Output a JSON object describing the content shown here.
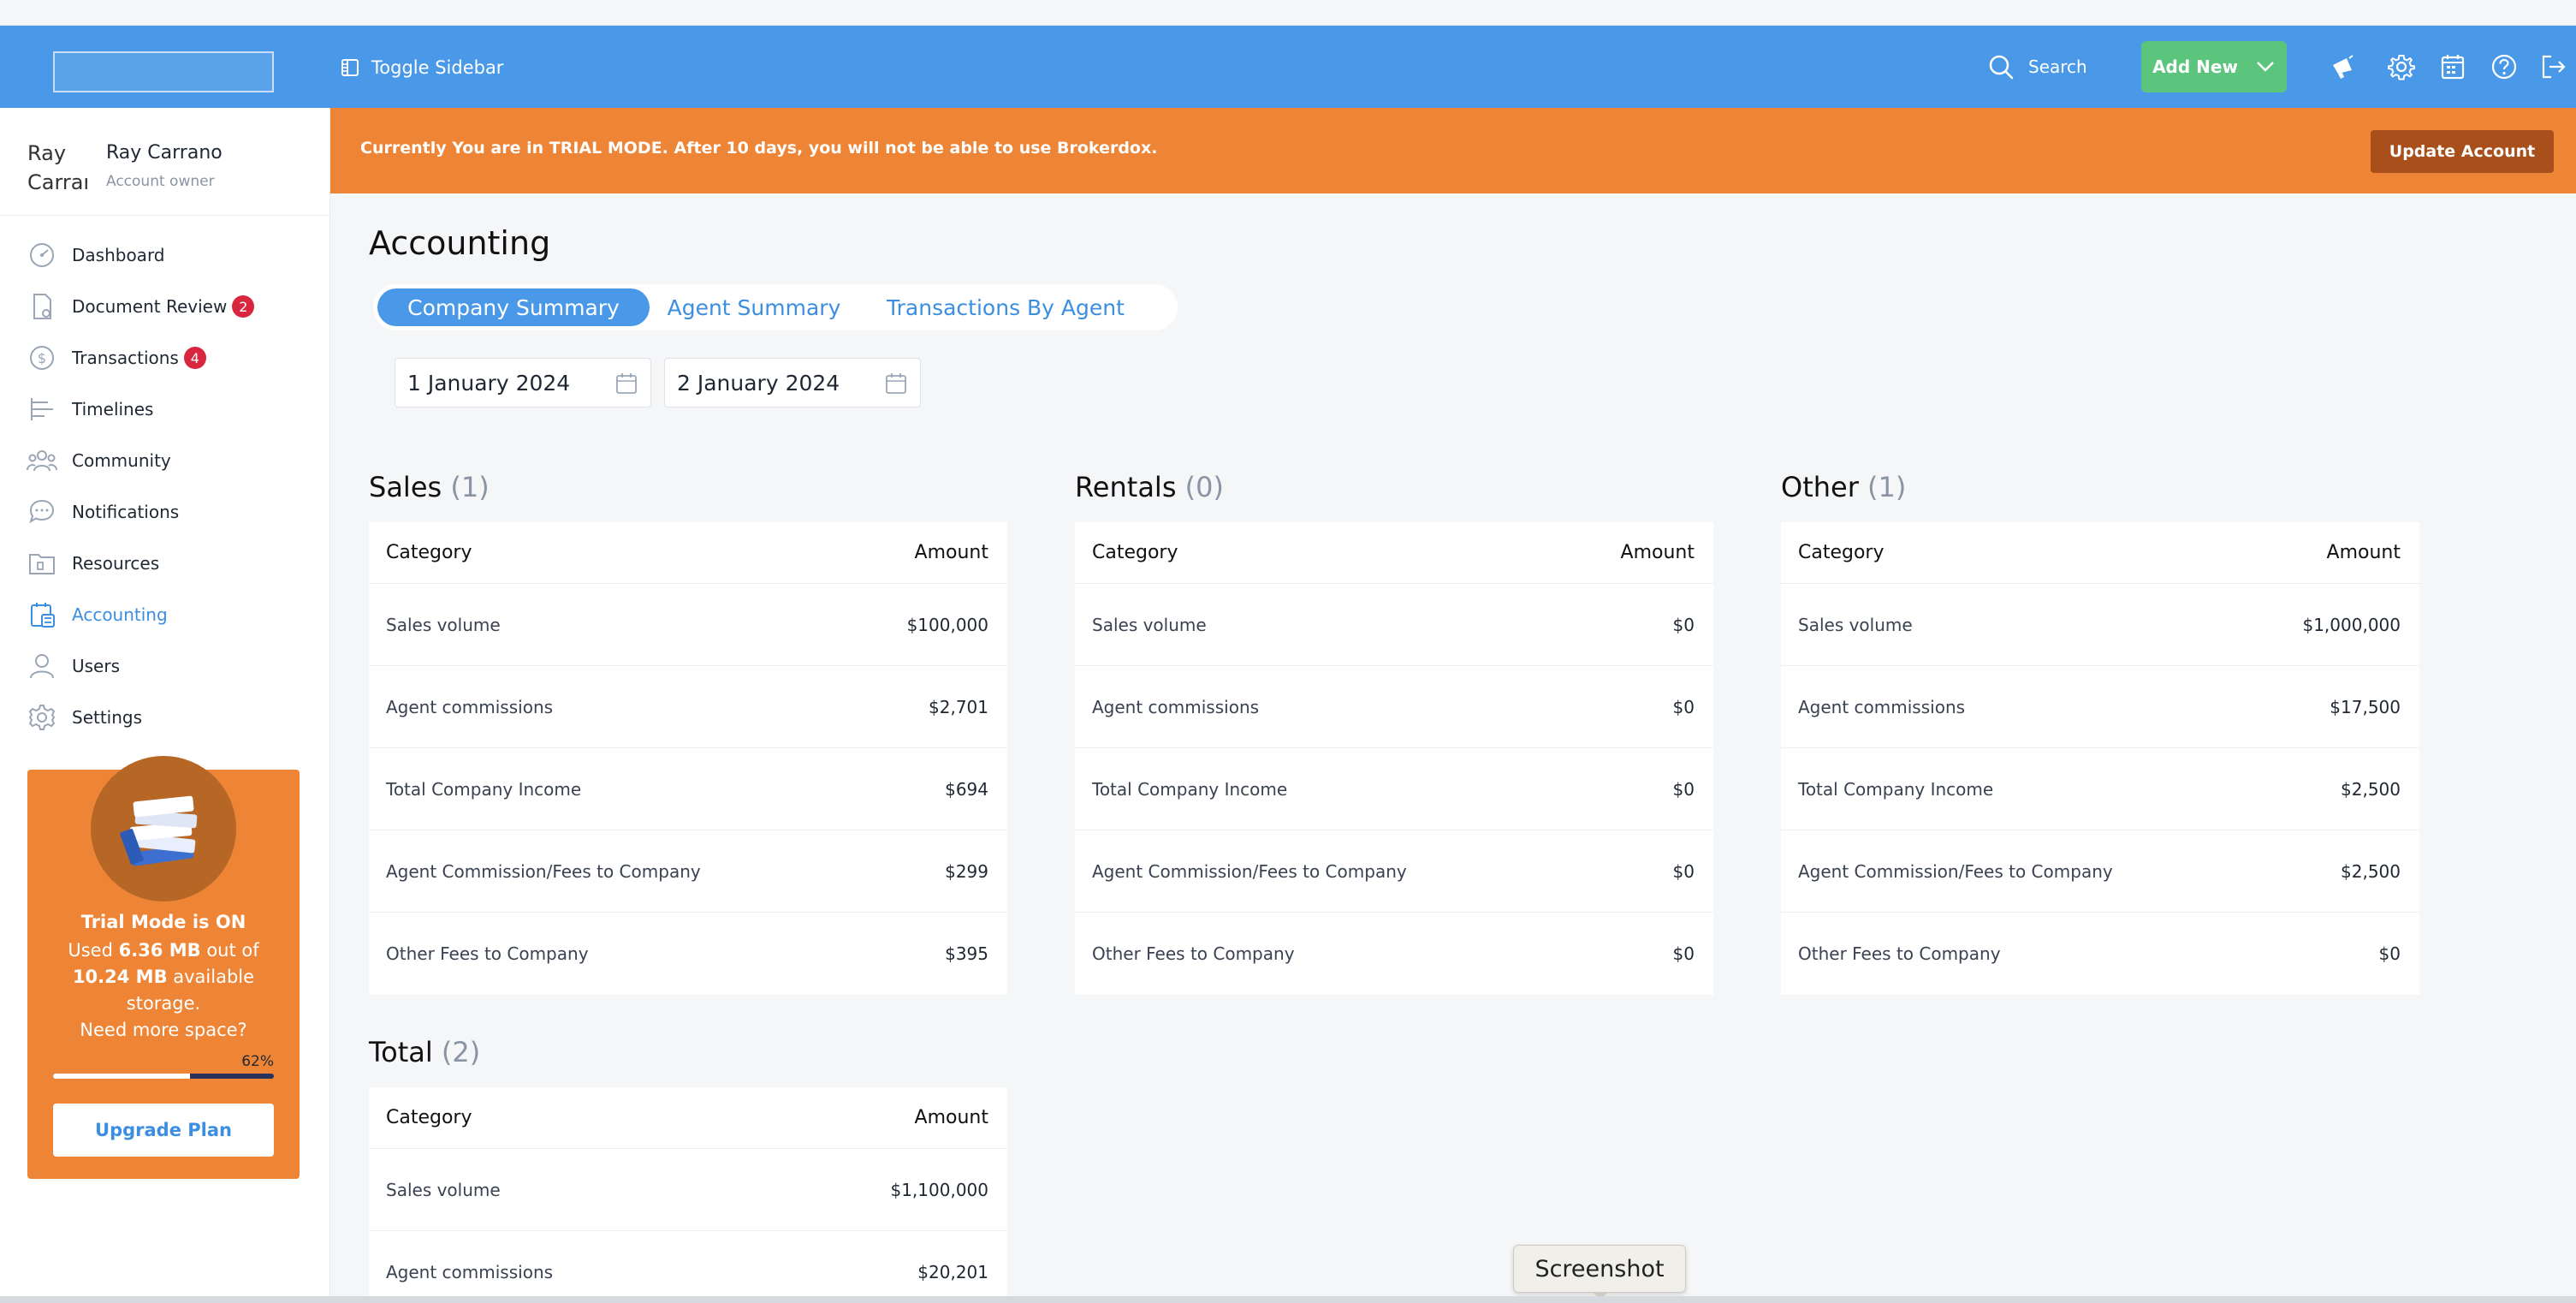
{
  "header": {
    "toggle_label": "Toggle Sidebar",
    "search_label": "Search",
    "add_new_label": "Add New",
    "accent": "#4a99e8"
  },
  "sidebar": {
    "user_name": "Ray Carrano",
    "user_role": "Account owner",
    "avatar_alt": "Ray Carrano",
    "items": [
      {
        "label": "Dashboard",
        "icon": "dashboard-icon"
      },
      {
        "label": "Document Review",
        "icon": "document-icon",
        "badge": "2"
      },
      {
        "label": "Transactions",
        "icon": "dollar-icon",
        "badge": "4"
      },
      {
        "label": "Timelines",
        "icon": "timeline-icon"
      },
      {
        "label": "Community",
        "icon": "community-icon"
      },
      {
        "label": "Notifications",
        "icon": "chat-icon"
      },
      {
        "label": "Resources",
        "icon": "folder-icon"
      },
      {
        "label": "Accounting",
        "icon": "accounting-icon",
        "active": true
      },
      {
        "label": "Users",
        "icon": "user-icon"
      },
      {
        "label": "Settings",
        "icon": "gear-icon"
      }
    ],
    "trial": {
      "title": "Trial Mode is ON",
      "used_prefix": "Used",
      "used": "6.36 MB",
      "out_of": "out of",
      "total": "10.24 MB",
      "available": "available storage.",
      "need_more": "Need more space?",
      "percent_label": "62%",
      "percent_value": 62,
      "upgrade_label": "Upgrade Plan"
    }
  },
  "banner": {
    "message": "Currently You are in TRIAL MODE. After 10 days, you will not be able to use Brokerdox.",
    "update_label": "Update Account"
  },
  "page": {
    "title": "Accounting",
    "tabs": [
      "Company Summary",
      "Agent Summary",
      "Transactions By Agent"
    ],
    "active_tab": 0,
    "date_from": "1 January 2024",
    "date_to": "2 January 2024"
  },
  "tables": {
    "col_category": "Category",
    "col_amount": "Amount",
    "sales": {
      "title": "Sales",
      "count": "(1)",
      "rows": [
        {
          "category": "Sales volume",
          "amount": "$100,000"
        },
        {
          "category": "Agent commissions",
          "amount": "$2,701"
        },
        {
          "category": "Total Company Income",
          "amount": "$694"
        },
        {
          "category": "Agent Commission/Fees to Company",
          "amount": "$299"
        },
        {
          "category": "Other Fees to Company",
          "amount": "$395"
        }
      ]
    },
    "rentals": {
      "title": "Rentals",
      "count": "(0)",
      "rows": [
        {
          "category": "Sales volume",
          "amount": "$0"
        },
        {
          "category": "Agent commissions",
          "amount": "$0"
        },
        {
          "category": "Total Company Income",
          "amount": "$0"
        },
        {
          "category": "Agent Commission/Fees to Company",
          "amount": "$0"
        },
        {
          "category": "Other Fees to Company",
          "amount": "$0"
        }
      ]
    },
    "other": {
      "title": "Other",
      "count": "(1)",
      "rows": [
        {
          "category": "Sales volume",
          "amount": "$1,000,000"
        },
        {
          "category": "Agent commissions",
          "amount": "$17,500"
        },
        {
          "category": "Total Company Income",
          "amount": "$2,500"
        },
        {
          "category": "Agent Commission/Fees to Company",
          "amount": "$2,500"
        },
        {
          "category": "Other Fees to Company",
          "amount": "$0"
        }
      ]
    },
    "total": {
      "title": "Total",
      "count": "(2)",
      "rows": [
        {
          "category": "Sales volume",
          "amount": "$1,100,000"
        },
        {
          "category": "Agent commissions",
          "amount": "$20,201"
        }
      ]
    }
  },
  "tooltip": {
    "text": "Screenshot"
  }
}
